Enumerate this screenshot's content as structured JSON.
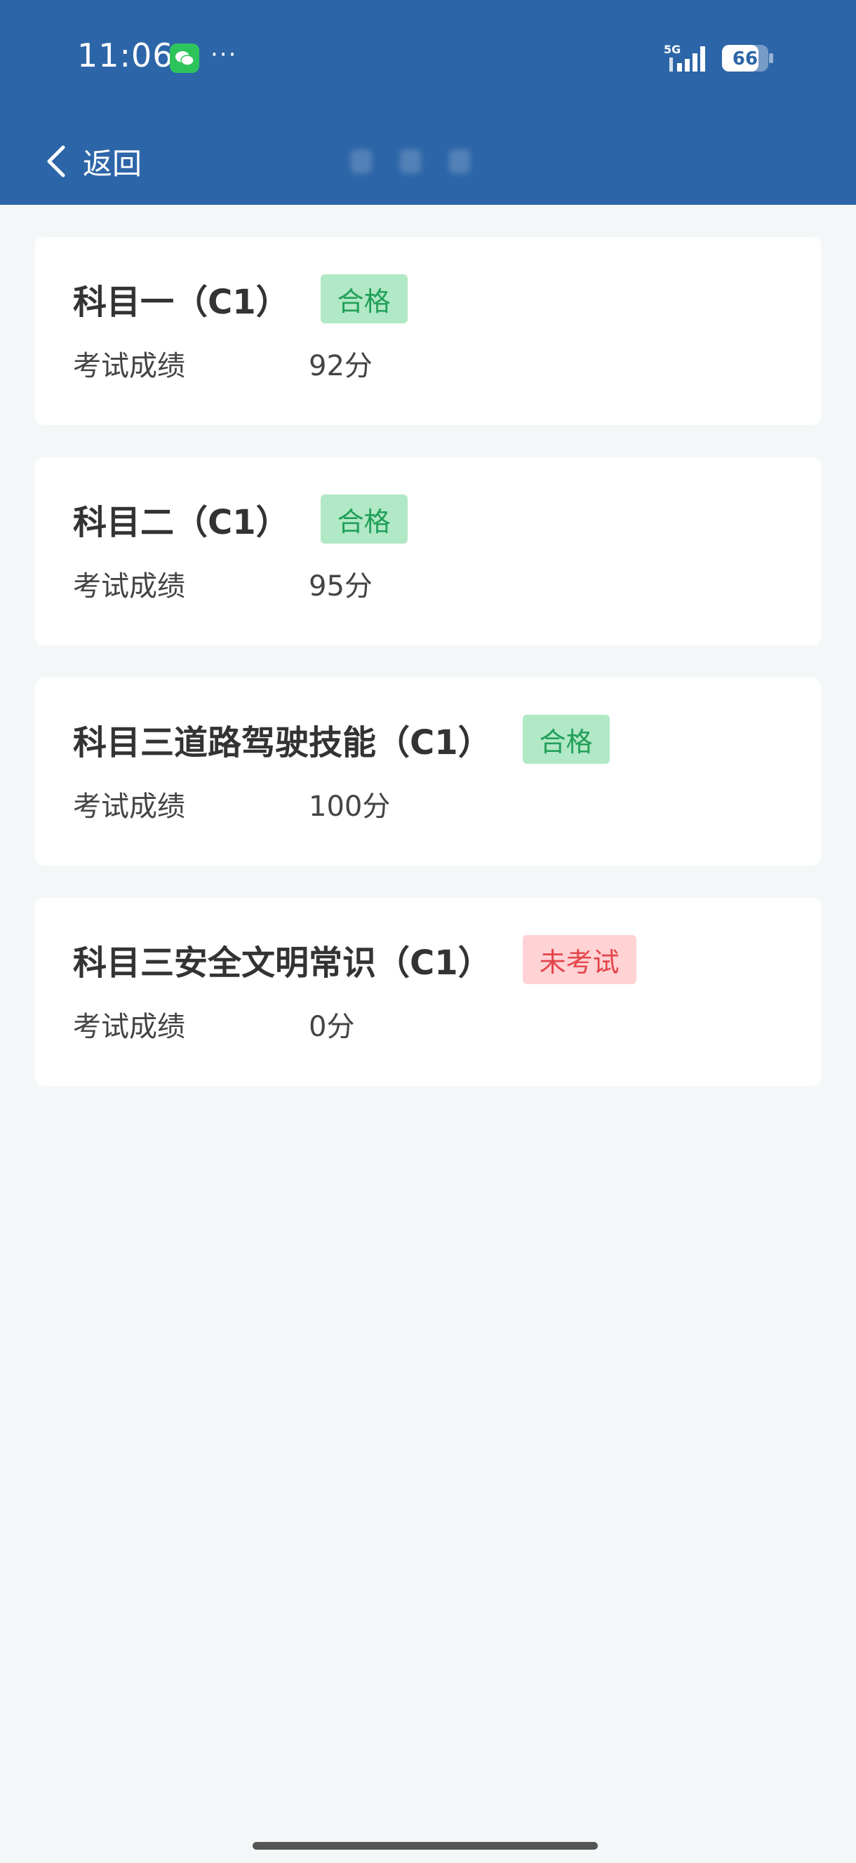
{
  "status_bar": {
    "time": "11:06",
    "more": "···",
    "network": "5G",
    "battery": "66"
  },
  "nav": {
    "back_label": "返回"
  },
  "results": [
    {
      "subject": "科目一（C1）",
      "status": "合格",
      "status_type": "pass",
      "score_label": "考试成绩",
      "score": "92分"
    },
    {
      "subject": "科目二（C1）",
      "status": "合格",
      "status_type": "pass",
      "score_label": "考试成绩",
      "score": "95分"
    },
    {
      "subject": "科目三道路驾驶技能（C1）",
      "status": "合格",
      "status_type": "pass",
      "score_label": "考试成绩",
      "score": "100分"
    },
    {
      "subject": "科目三安全文明常识（C1）",
      "status": "未考试",
      "status_type": "fail",
      "score_label": "考试成绩",
      "score": "0分"
    }
  ],
  "colors": {
    "header": "#2d66a8",
    "background": "#f3f7f8",
    "pass_bg": "#b1e8c5",
    "pass_text": "#22a05a",
    "fail_bg": "#ffd2d4",
    "fail_text": "#e4454a"
  }
}
